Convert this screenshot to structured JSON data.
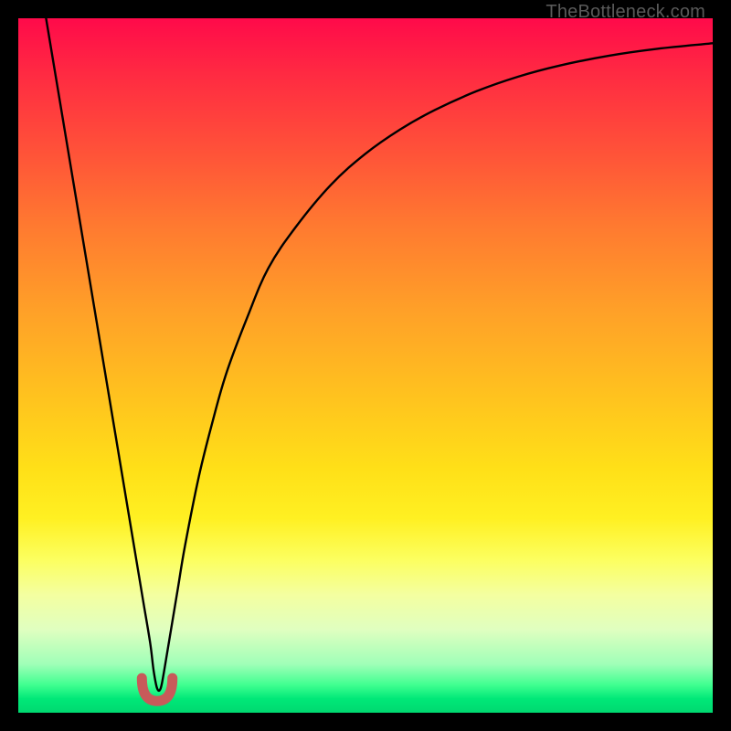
{
  "watermark": "TheBottleneck.com",
  "chart_data": {
    "type": "line",
    "title": "",
    "xlabel": "",
    "ylabel": "",
    "xlim": [
      0,
      100
    ],
    "ylim": [
      0,
      100
    ],
    "series": [
      {
        "name": "bottleneck-curve",
        "x": [
          4,
          6,
          8,
          10,
          12,
          14,
          15,
          16,
          17,
          18,
          19,
          19.5,
          20,
          20.5,
          21,
          22,
          23,
          24,
          26,
          28,
          30,
          33,
          36,
          40,
          45,
          50,
          55,
          60,
          66,
          72,
          78,
          85,
          92,
          100
        ],
        "values": [
          100,
          88,
          76,
          64,
          52,
          40,
          34,
          28,
          22,
          16,
          10,
          6,
          3.5,
          3.5,
          6,
          12,
          18,
          24,
          34,
          42,
          49,
          57,
          64,
          70,
          76,
          80.5,
          84,
          86.8,
          89.5,
          91.6,
          93.2,
          94.6,
          95.6,
          96.4
        ]
      }
    ],
    "annotations": [
      {
        "name": "marker-arc",
        "cx": 20,
        "cy": 3,
        "r": 2.2,
        "color": "#c85a5a"
      }
    ],
    "gradient_stops": [
      {
        "pct": 0,
        "color": "#ff0a4a"
      },
      {
        "pct": 20,
        "color": "#ff5538"
      },
      {
        "pct": 42,
        "color": "#ffa028"
      },
      {
        "pct": 65,
        "color": "#ffe018"
      },
      {
        "pct": 78,
        "color": "#fcff60"
      },
      {
        "pct": 93,
        "color": "#a0ffb8"
      },
      {
        "pct": 100,
        "color": "#00d870"
      }
    ]
  }
}
